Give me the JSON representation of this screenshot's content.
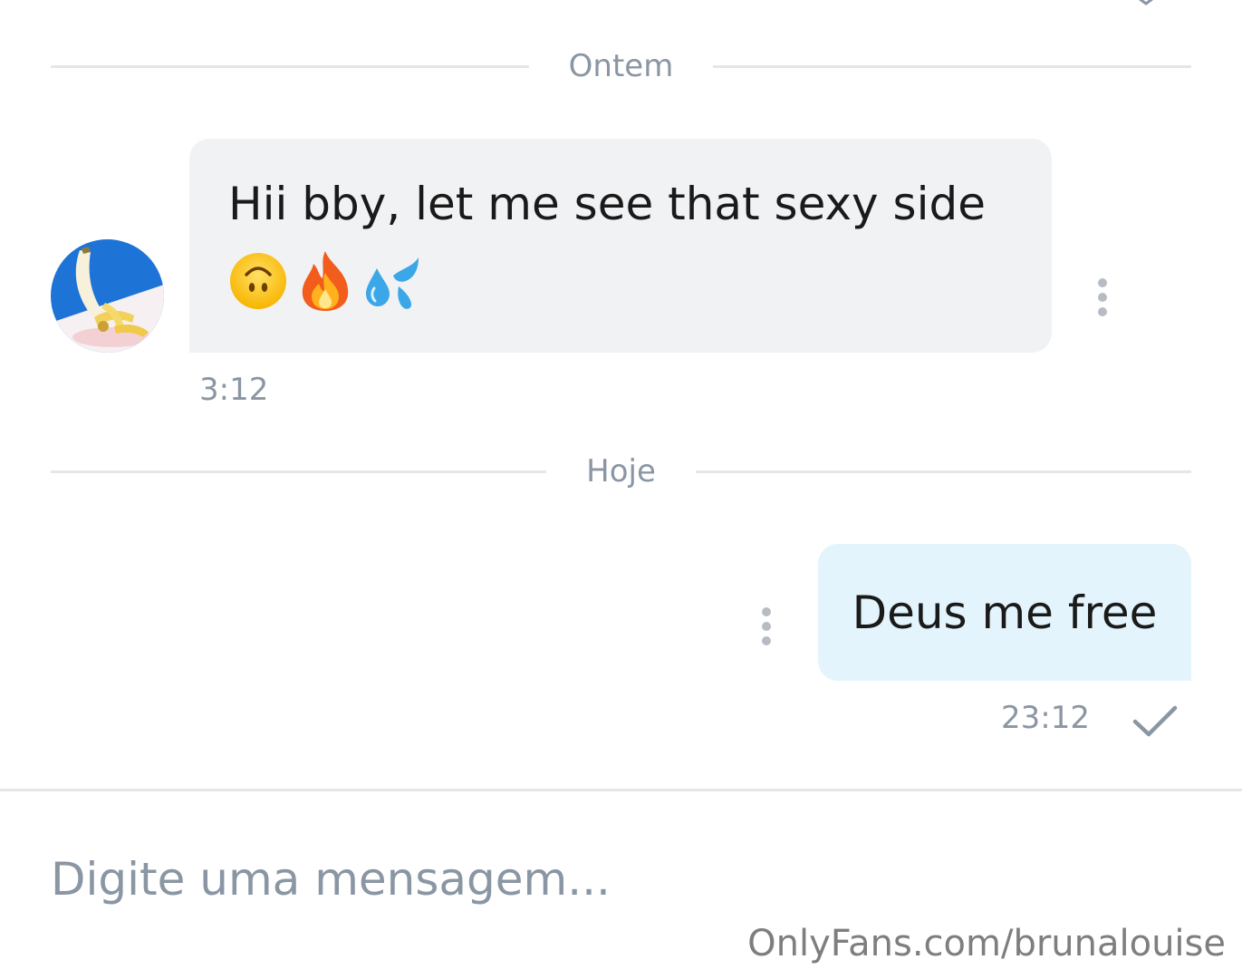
{
  "header": {
    "chevron_icon": "chevron-down-icon"
  },
  "dividers": {
    "yesterday": "Ontem",
    "today": "Hoje"
  },
  "messages": [
    {
      "direction": "incoming",
      "text": "Hii bby, let me see that sexy side",
      "emojis": [
        "upside-down-face-emoji",
        "fire-emoji",
        "sweat-droplets-emoji"
      ],
      "time": "3:12",
      "avatar_icon": "banana-avatar"
    },
    {
      "direction": "outgoing",
      "text": "Deus me free",
      "time": "23:12",
      "status_icon": "check-icon"
    }
  ],
  "composer": {
    "placeholder": "Digite uma mensagem..."
  },
  "watermark": "OnlyFans.com/brunalouise",
  "colors": {
    "incoming_bubble": "#f1f2f4",
    "outgoing_bubble": "#e3f4fc",
    "muted_text": "#8a96a3",
    "divider": "#e4e6ea"
  }
}
